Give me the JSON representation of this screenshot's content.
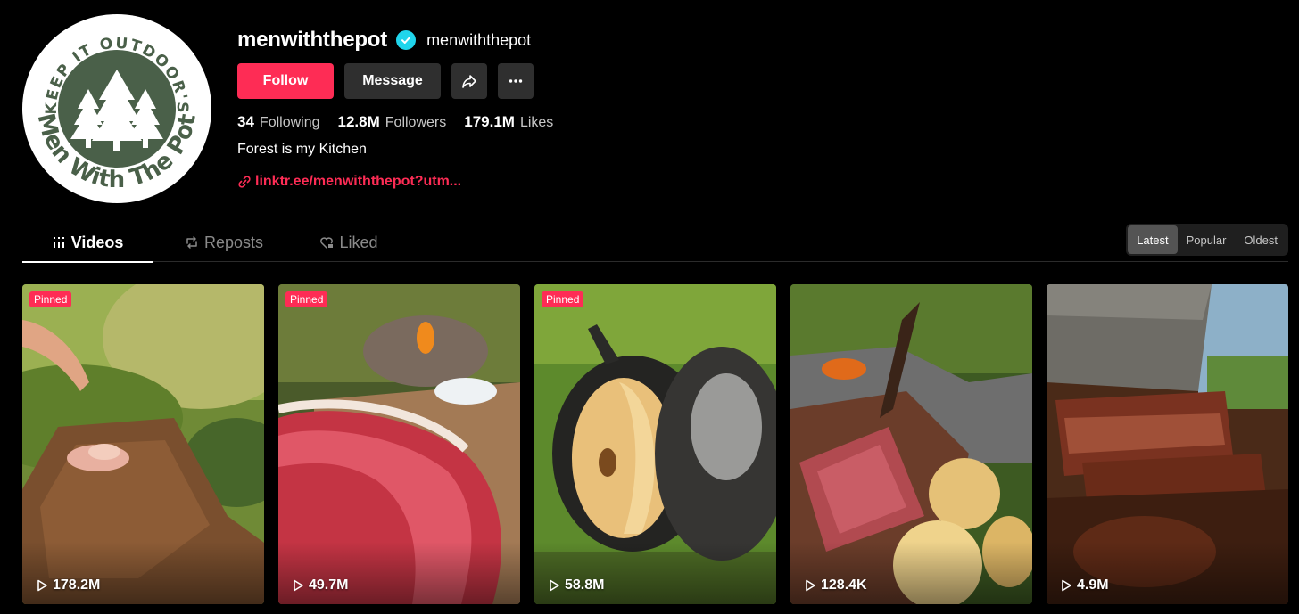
{
  "profile": {
    "username": "menwiththepot",
    "nickname": "menwiththepot",
    "verified": true,
    "avatar_text_top": "KEEP IT OUTDOOR'S",
    "avatar_text_bottom": "Men With The Pot",
    "follow_label": "Follow",
    "message_label": "Message",
    "share_icon": "share-icon",
    "more_icon": "more-icon",
    "bio": "Forest is my Kitchen",
    "link": "linktr.ee/menwiththepot?utm..."
  },
  "stats": [
    {
      "value": "34",
      "label": "Following"
    },
    {
      "value": "12.8M",
      "label": "Followers"
    },
    {
      "value": "179.1M",
      "label": "Likes"
    }
  ],
  "tabs": [
    {
      "label": "Videos",
      "icon": "grid-icon",
      "active": true
    },
    {
      "label": "Reposts",
      "icon": "repost-icon",
      "active": false
    },
    {
      "label": "Liked",
      "icon": "heart-lock-icon",
      "active": false
    }
  ],
  "sort": {
    "options": [
      "Latest",
      "Popular",
      "Oldest"
    ],
    "selected": "Latest"
  },
  "videos": [
    {
      "pinned_label": "Pinned",
      "views": "178.2M"
    },
    {
      "pinned_label": "Pinned",
      "views": "49.7M"
    },
    {
      "pinned_label": "Pinned",
      "views": "58.8M"
    },
    {
      "pinned_label": "",
      "views": "128.4K"
    },
    {
      "pinned_label": "",
      "views": "4.9M"
    }
  ],
  "colors": {
    "accent": "#fe2c55",
    "verified": "#20d5ec",
    "background": "#000000",
    "logo_green": "#4a6049"
  }
}
